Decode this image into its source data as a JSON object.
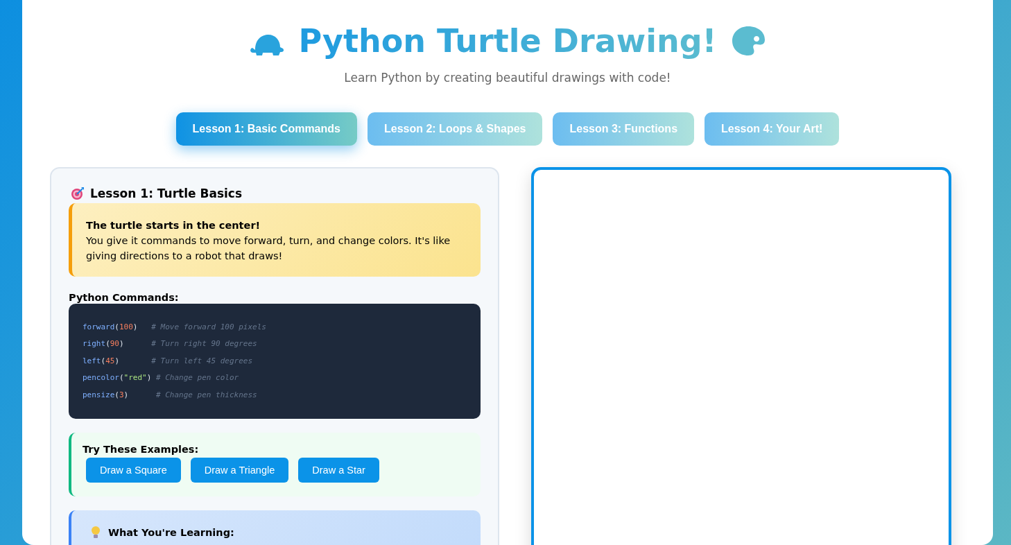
{
  "header": {
    "title": "Python Turtle Drawing!",
    "subtitle": "Learn Python by creating beautiful drawings with code!"
  },
  "tabs": [
    {
      "label": "Lesson 1: Basic Commands",
      "selected": true
    },
    {
      "label": "Lesson 2: Loops & Shapes",
      "selected": false
    },
    {
      "label": "Lesson 3: Functions",
      "selected": false
    },
    {
      "label": "Lesson 4: Your Art!",
      "selected": false
    }
  ],
  "lesson": {
    "title": "Lesson 1: Turtle Basics",
    "intro": {
      "heading": "The turtle starts in the center!",
      "text": "You give it commands to move forward, turn, and change colors. It's like giving directions to a robot that draws!"
    },
    "commands_heading": "Python Commands:",
    "code_lines": [
      [
        {
          "text": "forward",
          "kind": "func"
        },
        {
          "text": "(",
          "kind": "punct"
        },
        {
          "text": "100",
          "kind": "number"
        },
        {
          "text": ")",
          "kind": "punct"
        },
        {
          "text": "   # Move forward 100 pixels",
          "kind": "comment"
        }
      ],
      [
        {
          "text": "right",
          "kind": "func"
        },
        {
          "text": "(",
          "kind": "punct"
        },
        {
          "text": "90",
          "kind": "number"
        },
        {
          "text": ")",
          "kind": "punct"
        },
        {
          "text": "      # Turn right 90 degrees",
          "kind": "comment"
        }
      ],
      [
        {
          "text": "left",
          "kind": "func"
        },
        {
          "text": "(",
          "kind": "punct"
        },
        {
          "text": "45",
          "kind": "number"
        },
        {
          "text": ")",
          "kind": "punct"
        },
        {
          "text": "       # Turn left 45 degrees",
          "kind": "comment"
        }
      ],
      [
        {
          "text": "pencolor",
          "kind": "func"
        },
        {
          "text": "(",
          "kind": "punct"
        },
        {
          "text": "\"red\"",
          "kind": "string"
        },
        {
          "text": ")",
          "kind": "punct"
        },
        {
          "text": " # Change pen color",
          "kind": "comment"
        }
      ],
      [
        {
          "text": "pensize",
          "kind": "func"
        },
        {
          "text": "(",
          "kind": "punct"
        },
        {
          "text": "3",
          "kind": "number"
        },
        {
          "text": ")",
          "kind": "punct"
        },
        {
          "text": "      # Change pen thickness",
          "kind": "comment"
        }
      ]
    ],
    "examples": {
      "heading": "Try These Examples:",
      "buttons": [
        "Draw a Square",
        "Draw a Triangle",
        "Draw a Star"
      ]
    },
    "learning": {
      "heading": "What You're Learning:"
    }
  }
}
